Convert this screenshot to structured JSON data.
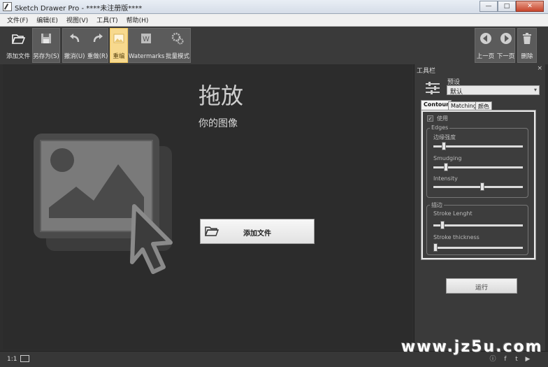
{
  "window": {
    "title": "Sketch Drawer Pro - ****未注册版****",
    "min_label": "—",
    "max_label": "□",
    "close_label": "✕"
  },
  "menu": [
    {
      "label": "文件(F)"
    },
    {
      "label": "编辑(E)"
    },
    {
      "label": "视图(V)"
    },
    {
      "label": "工具(T)"
    },
    {
      "label": "帮助(H)"
    }
  ],
  "toolbar": {
    "add_file": "添加文件",
    "save_as": "另存为(S)",
    "undo": "撤消(U)",
    "redo": "重做(R)",
    "edit": "重编",
    "watermarks": "Watermarks",
    "batch": "批量模式",
    "prev_page": "上一页",
    "next_page": "下一页",
    "delete": "删除",
    "edit_active": true
  },
  "canvas": {
    "drop_title": "拖放",
    "drop_subtitle": "你的图像",
    "add_button_label": "添加文件"
  },
  "panel": {
    "title": "工具栏",
    "close_label": "×",
    "preset_label": "预设",
    "preset_value": "默认",
    "tabs": [
      "Contour",
      "Matching",
      "颜色"
    ],
    "active_tab": "Contour",
    "use_label": "使用",
    "use_checked": true,
    "edges_group": "Edges",
    "edges_sliders": [
      {
        "label": "边缘强度",
        "value": 0.1
      },
      {
        "label": "Smudging",
        "value": 0.12
      },
      {
        "label": "Intensity",
        "value": 0.55
      }
    ],
    "stroke_group": "描边",
    "stroke_sliders": [
      {
        "label": "Stroke Lenght",
        "value": 0.08
      },
      {
        "label": "Stroke thickness",
        "value": 0.0
      }
    ],
    "run_label": "运行"
  },
  "status": {
    "zoom": "1:1"
  },
  "watermark_text": "www.jz5u.com",
  "colors": {
    "background": "#2c2c2c",
    "toolbar": "#3a3a3a",
    "active_tool": "#f7d98e"
  }
}
